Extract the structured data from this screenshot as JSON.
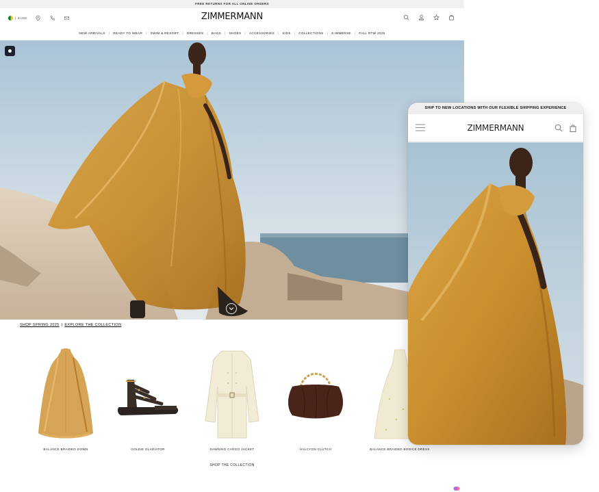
{
  "promo_bar": "FREE RETURNS FOR ALL ONLINE ORDERS",
  "header": {
    "currency": "$ USD",
    "currency_sep": "|",
    "logo": "ZIMMERMANN",
    "left_icons": [
      "location-pin-icon",
      "phone-icon",
      "mail-icon"
    ],
    "right_icons": [
      "search-icon",
      "account-icon",
      "wishlist-star-icon",
      "bag-icon"
    ]
  },
  "nav": {
    "items": [
      "NEW ARRIVALS",
      "READY TO WEAR",
      "SWIM & RESORT",
      "DRESSES",
      "BAGS",
      "SHOES",
      "ACCESSORIES",
      "KIDS",
      "COLLECTIONS",
      "Z.IMMERSE",
      "FALL RTW 2025"
    ],
    "separator": "|"
  },
  "hero": {
    "cta_primary": "SHOP SPRING 2025",
    "cta_sep": "|",
    "cta_secondary": "EXPLORE THE COLLECTION"
  },
  "products": [
    {
      "name": "BALANCE BRAIDED GOWN",
      "icon": "gown-image"
    },
    {
      "name": "GOLDIE GLADIATOR",
      "icon": "sandal-image"
    },
    {
      "name": "DAWNING CARGO JACKET",
      "icon": "jacket-image"
    },
    {
      "name": "HALCYON CLUTCH",
      "icon": "clutch-image"
    },
    {
      "name": "BALANCE BRAIDED BODICE DRESS",
      "icon": "dress-image"
    }
  ],
  "shop_collection": "SHOP THE COLLECTION",
  "mobile": {
    "promo": "SHIP TO NEW LOCATIONS WITH OUR FLEXIBLE SHIPPING EXPERIENCE",
    "logo": "ZIMMERMANN"
  },
  "colors": {
    "gown": "#c9922f",
    "sky": "#bcd0dc",
    "sand": "#d8c6ae",
    "sea": "#6f8ea0",
    "accent_badge": "#1b1f2e"
  }
}
